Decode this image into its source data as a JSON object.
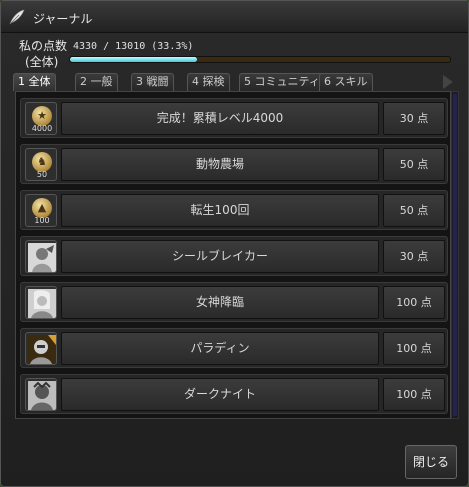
{
  "window": {
    "title": "ジャーナル",
    "icon": "feather-icon"
  },
  "points": {
    "label_line1": "私の点数",
    "label_line2": "(全体)",
    "value_text": "4330 / 13010 (33.3%)",
    "progress": 0.333
  },
  "tabs": [
    {
      "label": "1 全体",
      "active": true
    },
    {
      "label": "2 一般",
      "active": false
    },
    {
      "label": "3 戦闘",
      "active": false
    },
    {
      "label": "4 探検",
      "active": false
    },
    {
      "label": "5 コミュニティ",
      "active": false
    },
    {
      "label": "6 スキル",
      "active": false
    }
  ],
  "entries": [
    {
      "name": "完成！累積レベル4000",
      "points": "30 点",
      "badge_type": "coin",
      "badge_text": "4000",
      "icon": "star-icon"
    },
    {
      "name": "動物農場",
      "points": "50 点",
      "badge_type": "coin",
      "badge_text": "50",
      "icon": "animal-icon"
    },
    {
      "name": "転生100回",
      "points": "50 点",
      "badge_type": "coin",
      "badge_text": "100",
      "icon": "triangle-icon"
    },
    {
      "name": "シールブレイカー",
      "points": "30 点",
      "badge_type": "portrait",
      "badge_text": "",
      "icon": "shieldbreaker-portrait-icon"
    },
    {
      "name": "女神降臨",
      "points": "100 点",
      "badge_type": "portrait",
      "badge_text": "",
      "icon": "goddess-portrait-icon"
    },
    {
      "name": "パラディン",
      "points": "100 点",
      "badge_type": "portrait",
      "badge_text": "",
      "icon": "paladin-portrait-icon"
    },
    {
      "name": "ダークナイト",
      "points": "100 点",
      "badge_type": "portrait",
      "badge_text": "",
      "icon": "darkknight-portrait-icon"
    }
  ],
  "close_label": "閉じる"
}
